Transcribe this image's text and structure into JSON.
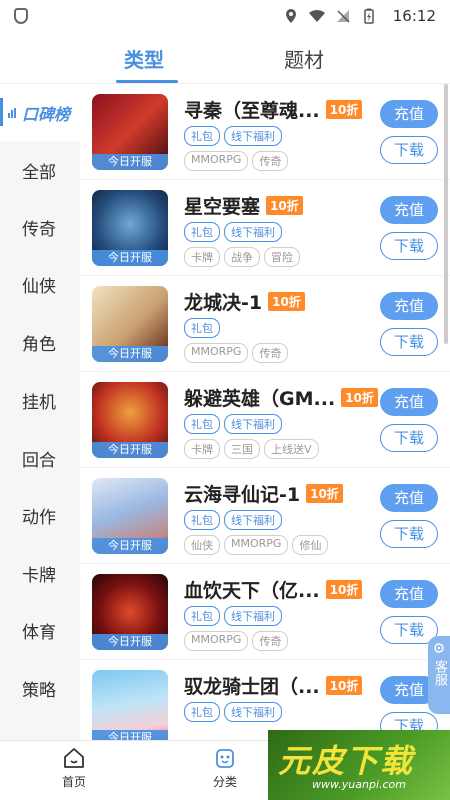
{
  "status_bar": {
    "time": "16:12"
  },
  "top_tabs": [
    {
      "label": "类型",
      "active": true
    },
    {
      "label": "题材",
      "active": false
    }
  ],
  "sidebar": {
    "items": [
      {
        "label": "口碑榜",
        "active": true
      },
      {
        "label": "全部"
      },
      {
        "label": "传奇"
      },
      {
        "label": "仙侠"
      },
      {
        "label": "角色"
      },
      {
        "label": "挂机"
      },
      {
        "label": "回合"
      },
      {
        "label": "动作"
      },
      {
        "label": "卡牌"
      },
      {
        "label": "体育"
      },
      {
        "label": "策略"
      }
    ]
  },
  "games": [
    {
      "name": "寻秦（至尊魂...",
      "discount": "10折",
      "open_label": "今日开服",
      "blue_tags": [
        "礼包",
        "线下福利"
      ],
      "gray_tags": [
        "MMORPG",
        "传奇"
      ],
      "recharge": "充值",
      "download": "下载"
    },
    {
      "name": "星空要塞",
      "discount": "10折",
      "open_label": "今日开服",
      "blue_tags": [
        "礼包",
        "线下福利"
      ],
      "gray_tags": [
        "卡牌",
        "战争",
        "冒险"
      ],
      "recharge": "充值",
      "download": "下载"
    },
    {
      "name": "龙城决-1",
      "discount": "10折",
      "open_label": "今日开服",
      "blue_tags": [
        "礼包"
      ],
      "gray_tags": [
        "MMORPG",
        "传奇"
      ],
      "recharge": "充值",
      "download": "下载"
    },
    {
      "name": "躲避英雄（GM...",
      "discount": "10折",
      "open_label": "今日开服",
      "blue_tags": [
        "礼包",
        "线下福利"
      ],
      "gray_tags": [
        "卡牌",
        "三国",
        "上线送V"
      ],
      "recharge": "充值",
      "download": "下载"
    },
    {
      "name": "云海寻仙记-1",
      "discount": "10折",
      "open_label": "今日开服",
      "blue_tags": [
        "礼包",
        "线下福利"
      ],
      "gray_tags": [
        "仙侠",
        "MMORPG",
        "修仙"
      ],
      "recharge": "充值",
      "download": "下载"
    },
    {
      "name": "血饮天下（亿...",
      "discount": "10折",
      "open_label": "今日开服",
      "blue_tags": [
        "礼包",
        "线下福利"
      ],
      "gray_tags": [
        "MMORPG",
        "传奇"
      ],
      "recharge": "充值",
      "download": "下载"
    },
    {
      "name": "驭龙骑士团（...",
      "discount": "10折",
      "open_label": "今日开服",
      "blue_tags": [
        "礼包",
        "线下福利"
      ],
      "gray_tags": [],
      "recharge": "充值",
      "download": "下载"
    }
  ],
  "service_tab": "客服",
  "bottom_nav": [
    {
      "label": "首页",
      "icon": "home-icon"
    },
    {
      "label": "分类",
      "icon": "category-icon"
    }
  ],
  "watermark": {
    "main": "元皮下载",
    "url": "www.yuanpi.com"
  },
  "colors": {
    "accent": "#4a90e2",
    "discount": "#ff8a2a",
    "recharge_bg": "#5e9ff0"
  }
}
